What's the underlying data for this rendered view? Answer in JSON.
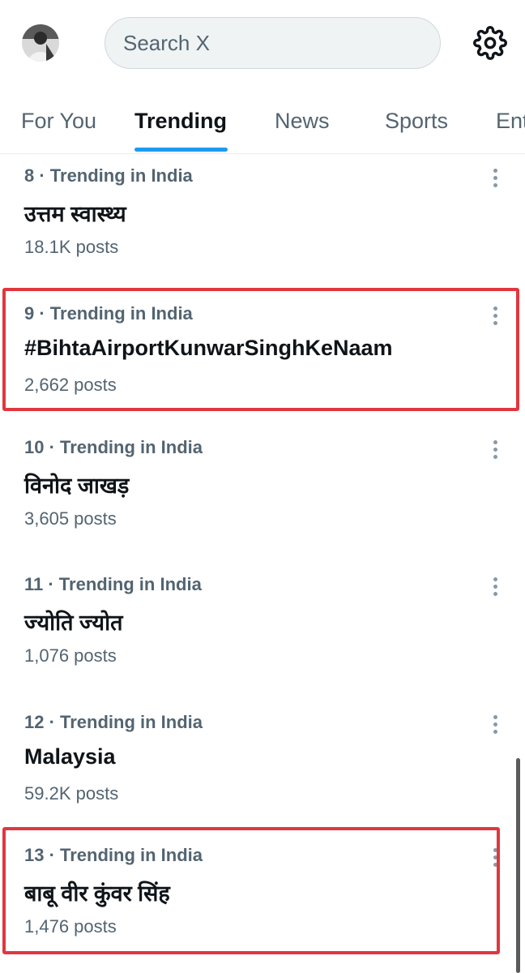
{
  "search": {
    "placeholder": "Search X"
  },
  "icons": {
    "avatar": "avatar-photo",
    "settings": "gear-icon",
    "more": "more-vertical-icon"
  },
  "colors": {
    "accent": "#1d9bf0",
    "highlight": "#e0373f",
    "secondary_text": "#536471"
  },
  "tabs": [
    {
      "label": "For You"
    },
    {
      "label": "Trending"
    },
    {
      "label": "News"
    },
    {
      "label": "Sports"
    },
    {
      "label": "Ent"
    }
  ],
  "trends": [
    {
      "meta": "8 · Trending in India",
      "name": "उत्तम स्वास्थ्य",
      "count": "18.1K posts"
    },
    {
      "meta": "9 · Trending in India",
      "name": "#BihtaAirportKunwarSinghKeNaam",
      "count": "2,662 posts"
    },
    {
      "meta": "10 · Trending in India",
      "name": "विनोद जाखड़",
      "count": "3,605 posts"
    },
    {
      "meta": "11 · Trending in India",
      "name": "ज्योति ज्योत",
      "count": "1,076 posts"
    },
    {
      "meta": "12 · Trending in India",
      "name": "Malaysia",
      "count": "59.2K posts"
    },
    {
      "meta": "13 · Trending in India",
      "name": "बाबू वीर कुंवर सिंह",
      "count": "1,476 posts"
    }
  ]
}
